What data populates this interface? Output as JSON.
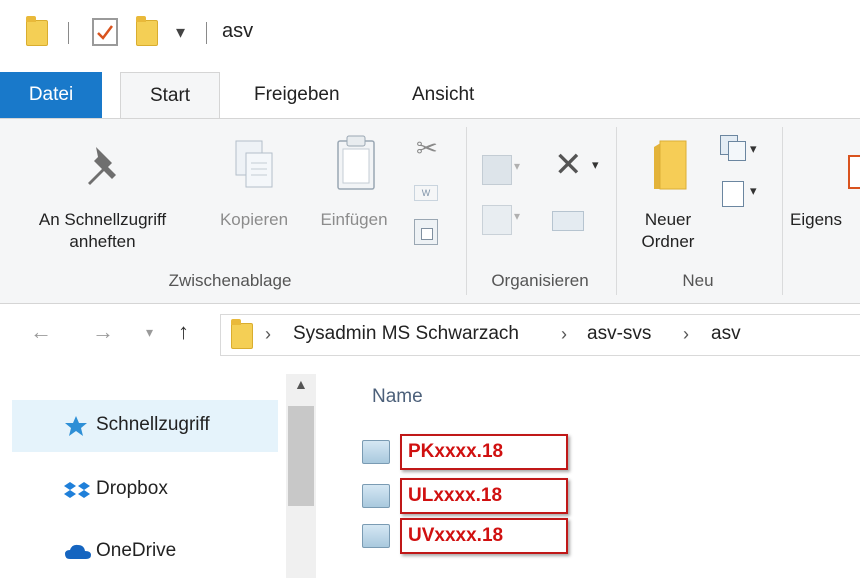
{
  "window": {
    "title": "asv"
  },
  "tabs": [
    {
      "label": "Datei"
    },
    {
      "label": "Start"
    },
    {
      "label": "Freigeben"
    },
    {
      "label": "Ansicht"
    }
  ],
  "ribbon": {
    "pin": {
      "label_line1": "An Schnellzugriff",
      "label_line2": "anheften"
    },
    "copy": {
      "label": "Kopieren"
    },
    "paste": {
      "label": "Einfügen"
    },
    "new_folder": {
      "label_line1": "Neuer",
      "label_line2": "Ordner"
    },
    "properties": {
      "label": "Eigens"
    },
    "groups": [
      {
        "label": "Zwischenablage"
      },
      {
        "label": "Organisieren"
      },
      {
        "label": "Neu"
      }
    ]
  },
  "address": {
    "crumbs": [
      "Sysadmin MS Schwarzach",
      "asv-svs",
      "asv"
    ]
  },
  "nav_pane": {
    "items": [
      {
        "label": "Schnellzugriff",
        "icon": "star-icon"
      },
      {
        "label": "Dropbox",
        "icon": "dropbox-icon"
      },
      {
        "label": "OneDrive",
        "icon": "cloud-icon"
      }
    ]
  },
  "files": {
    "column_header": "Name",
    "items": [
      {
        "name": "PKxxxx.18"
      },
      {
        "name": "ULxxxx.18"
      },
      {
        "name": "UVxxxx.18"
      }
    ]
  },
  "colors": {
    "accent": "#1979ca",
    "highlight_border": "#c01818",
    "highlight_text": "#d01010"
  }
}
